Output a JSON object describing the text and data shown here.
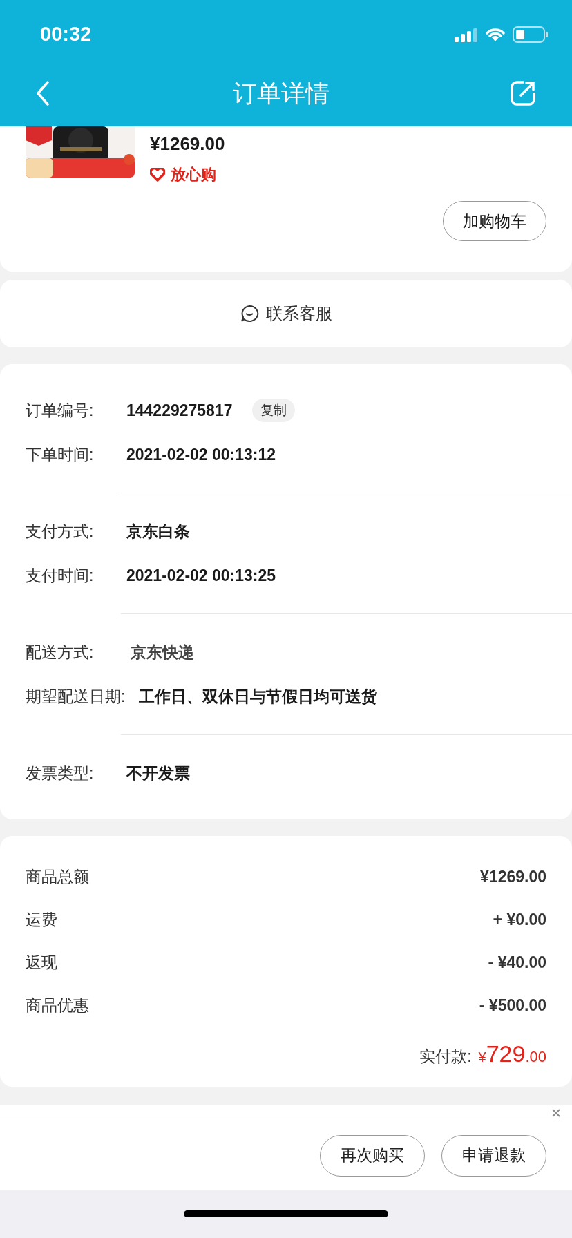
{
  "status_bar": {
    "time": "00:32"
  },
  "nav": {
    "title": "订单详情"
  },
  "product": {
    "kind": "picture",
    "price": "¥1269.00",
    "guarantee": "放心购",
    "cart_button": "加购物车"
  },
  "service": {
    "label": "联系客服"
  },
  "order_info": {
    "groups": [
      [
        {
          "label": "订单编号:",
          "value": "144229275817",
          "action": "复制"
        },
        {
          "label": "下单时间:",
          "value": "2021-02-02 00:13:12"
        }
      ],
      [
        {
          "label": "支付方式:",
          "value": "京东白条"
        },
        {
          "label": "支付时间:",
          "value": "2021-02-02 00:13:25"
        }
      ],
      [
        {
          "label": "配送方式:",
          "value": "京东快递",
          "emphasis": true
        },
        {
          "label": "期望配送日期:",
          "value": "工作日、双休日与节假日均可送货"
        }
      ],
      [
        {
          "label": "发票类型:",
          "value": "不开发票"
        }
      ]
    ]
  },
  "costs": {
    "rows": [
      {
        "label": "商品总额",
        "value": "¥1269.00"
      },
      {
        "label": "运费",
        "value": "+ ¥0.00"
      },
      {
        "label": "返现",
        "value": "- ¥40.00"
      },
      {
        "label": "商品优惠",
        "value": "- ¥500.00"
      }
    ],
    "total": {
      "label": "实付款:",
      "currency": "¥",
      "integer": "729",
      "decimal": ".00"
    }
  },
  "bottom_bar": {
    "buttons": [
      "再次购买",
      "申请退款"
    ]
  }
}
